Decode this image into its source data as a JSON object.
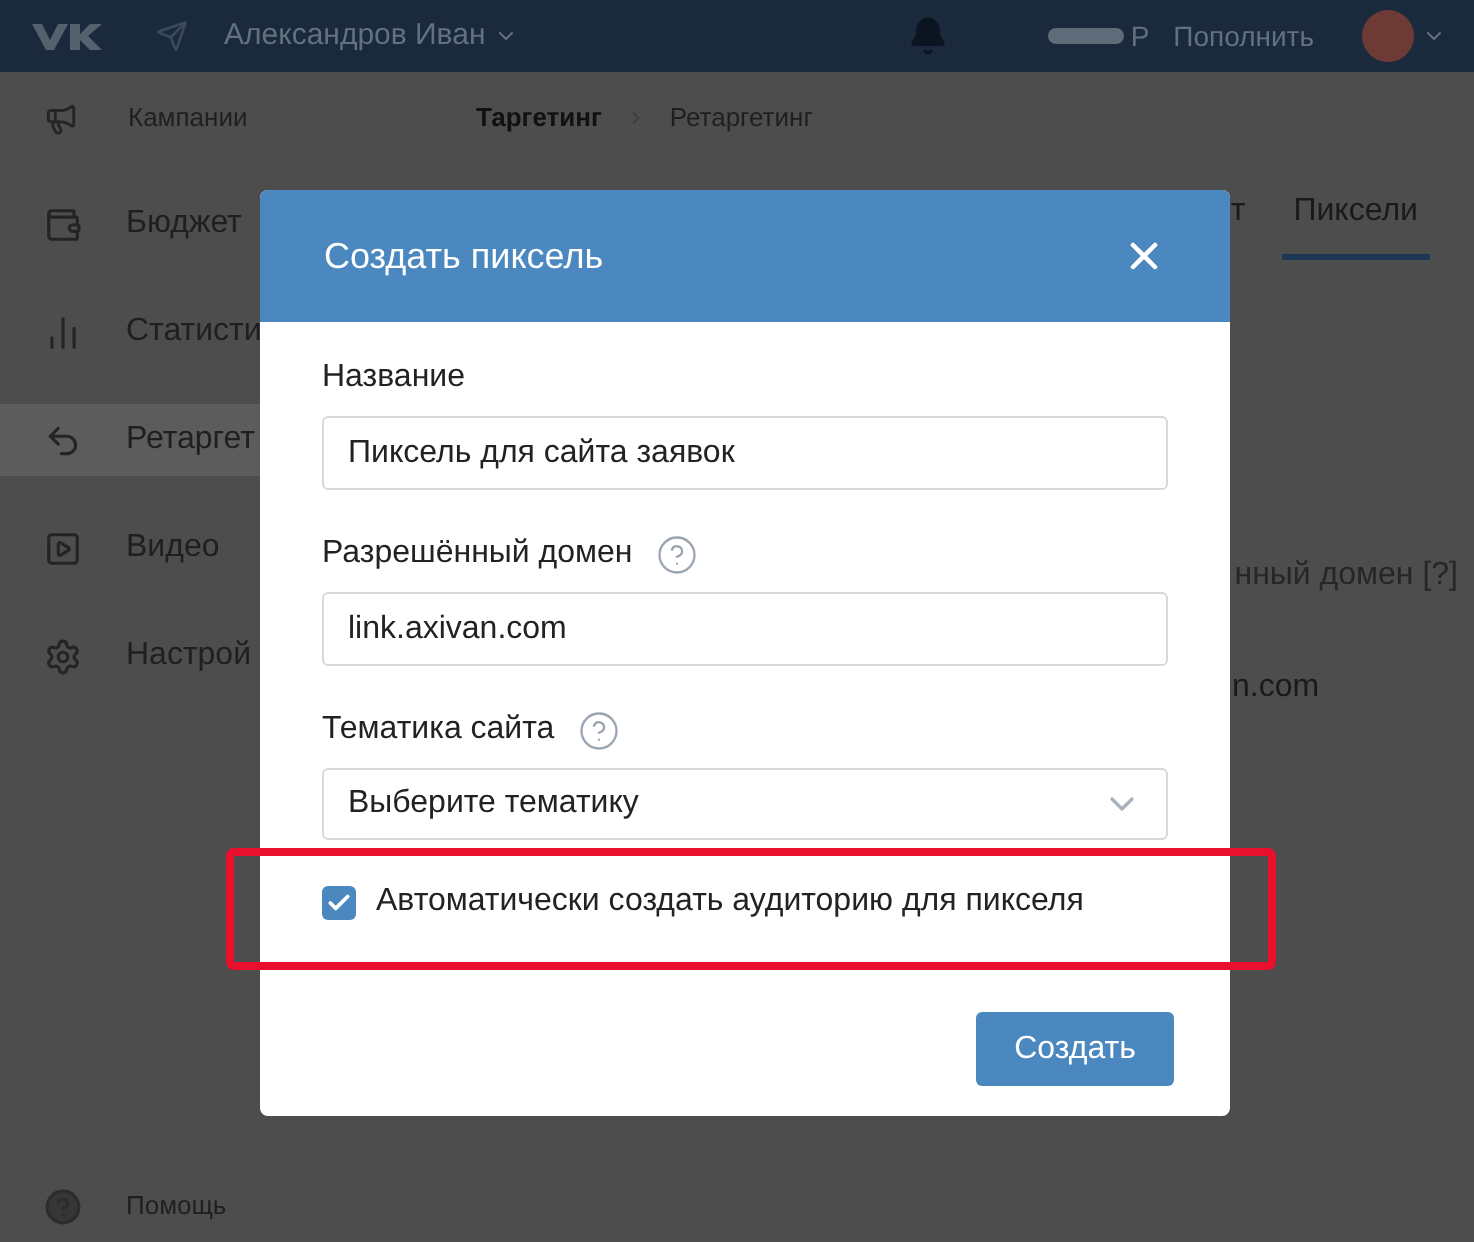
{
  "header": {
    "user_name": "Александров Иван",
    "currency": "Р",
    "top_up": "Пополнить"
  },
  "sidebar": {
    "items": [
      {
        "label": "Кампании",
        "selected": false
      },
      {
        "label": "Бюджет",
        "selected": false
      },
      {
        "label": "Статисти",
        "selected": false
      },
      {
        "label": "Ретаргет",
        "selected": true
      },
      {
        "label": "Видео",
        "selected": false
      },
      {
        "label": "Настрой",
        "selected": false
      }
    ],
    "help": "Помощь"
  },
  "breadcrumbs": [
    "Таргетинг",
    "Ретаргетинг"
  ],
  "tabs": [
    {
      "label": "т",
      "selected": false
    },
    {
      "label": "Пиксели",
      "selected": true
    }
  ],
  "table": {
    "column_header": "нный домен [?]",
    "cell": "n.com"
  },
  "dialog": {
    "title": "Создать пиксель",
    "fields": [
      {
        "kind": "text",
        "label": "Название",
        "value": "Пиксель для сайта заявок"
      },
      {
        "kind": "text",
        "label": "Разрешённый домен",
        "help": true,
        "value": "link.axivan.com"
      },
      {
        "kind": "select",
        "label": "Тематика сайта",
        "help": true,
        "value": "Выберите тематику"
      }
    ],
    "checkbox": {
      "label": "Автоматически создать аудиторию для пикселя",
      "checked": true,
      "highlighted": true
    },
    "button": "Создать"
  }
}
